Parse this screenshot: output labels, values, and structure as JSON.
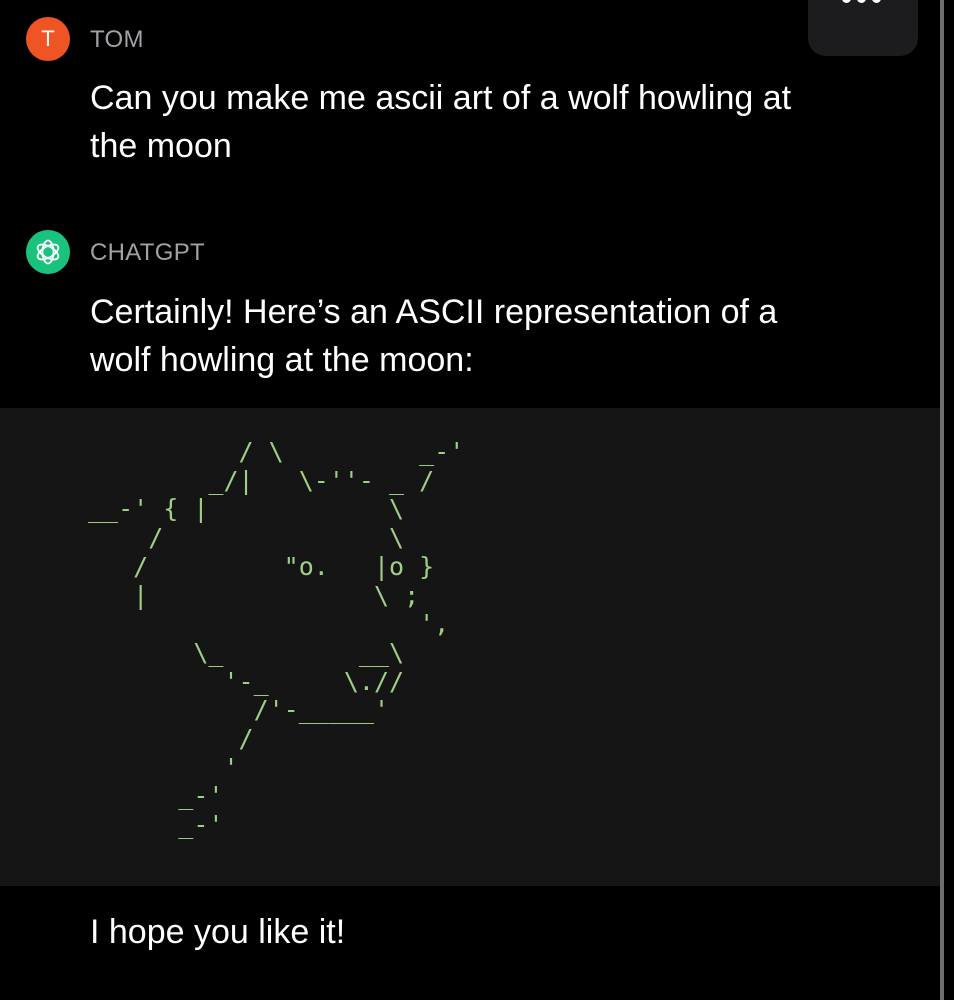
{
  "header": {
    "menu_icon": "ellipsis-icon"
  },
  "messages": [
    {
      "avatar_letter": "T",
      "avatar_color": "#ef5524",
      "sender": "TOM",
      "text": "Can you make me ascii art of a wolf howling at\nthe moon"
    },
    {
      "avatar_icon": "openai-logo-icon",
      "avatar_color": "#19c37d",
      "sender": "CHATGPT",
      "text": "Certainly! Here’s an ASCII representation of a\nwolf howling at the moon:",
      "code": "          / \\         _-'\n        _/|   \\-''- _ /\n__-' { |            \\\n    /               \\\n   /         \"o.   |o }\n   |               \\ ;\n                      ',\n       \\_         __\\\n         '-_     \\.//\n           /'-_____'\n          /\n         '\n      _-'\n      _-'",
      "closing": "I hope you like it!"
    }
  ],
  "colors": {
    "background": "#000000",
    "code_background": "#151515",
    "code_text": "#9fcf86",
    "sender_text": "#a1a1a6"
  }
}
